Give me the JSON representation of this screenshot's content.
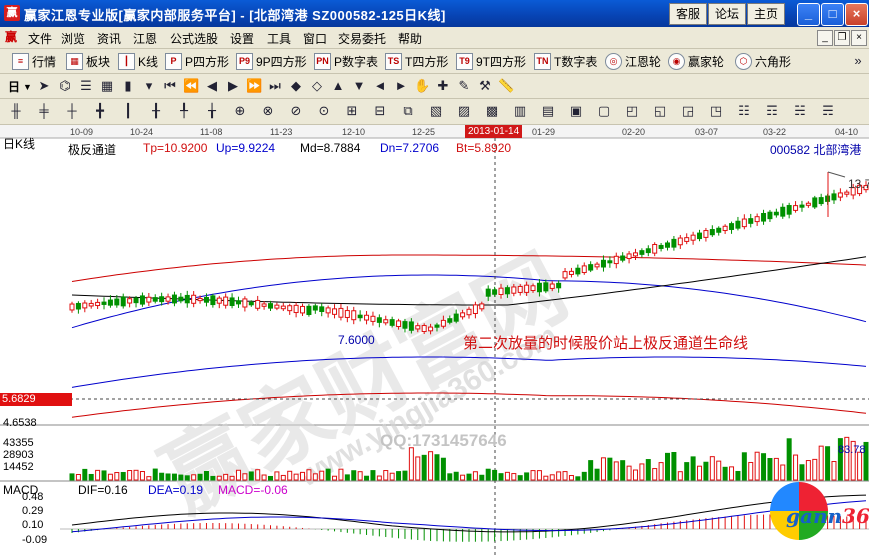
{
  "window": {
    "title": "赢家江恩专业版[赢家内部服务平台] - [北部湾港   SZ000582-125日K线]",
    "top_buttons": [
      "客服",
      "论坛",
      "主页"
    ],
    "controls": [
      "_",
      "□",
      "×"
    ]
  },
  "menu": {
    "items": [
      "文件",
      "浏览",
      "资讯",
      "江恩",
      "公式选股",
      "设置",
      "工具",
      "窗口",
      "交易委托",
      "帮助"
    ],
    "mdi_controls": [
      "_",
      "❐",
      "×"
    ]
  },
  "toolbar1": {
    "items": [
      {
        "icon": "list-icon",
        "label": "行情"
      },
      {
        "icon": "blocks-icon",
        "label": "板块"
      },
      {
        "icon": "candle-icon",
        "label": "K线"
      },
      {
        "icon": "P",
        "label": "P四方形"
      },
      {
        "icon": "P9",
        "label": "9P四方形"
      },
      {
        "icon": "PN",
        "label": "P数字表"
      },
      {
        "icon": "TS",
        "label": "T四方形"
      },
      {
        "icon": "T9",
        "label": "9T四方形"
      },
      {
        "icon": "TN",
        "label": "T数字表"
      },
      {
        "icon": "gann-wheel-icon",
        "label": "江恩轮"
      },
      {
        "icon": "winner-wheel-icon",
        "label": "赢家轮"
      },
      {
        "icon": "hexagon-icon",
        "label": "六角形"
      }
    ]
  },
  "toolbar2": {
    "period": "日",
    "icons": [
      "cursor-icon",
      "tree-icon",
      "stack-icon",
      "chart-icon",
      "bar-icon",
      "dropdown-icon",
      "first-icon",
      "prev-page-icon",
      "left-icon",
      "right-icon",
      "next-page-icon",
      "last-icon",
      "zoom-in-icon",
      "zoom-out-icon",
      "move-up-icon",
      "move-down-icon",
      "move-left-icon",
      "move-right-icon",
      "hand-icon",
      "crosshair-icon",
      "pen-icon",
      "tools-icon",
      "ruler-icon"
    ]
  },
  "toolbar3": {
    "icons": [
      "draw1-icon",
      "draw2-icon",
      "draw3-icon",
      "draw4-icon",
      "draw5-icon",
      "draw6-icon",
      "draw7-icon",
      "draw8-icon",
      "draw9-icon",
      "draw10-icon",
      "draw11-icon",
      "draw12-icon",
      "draw13-icon",
      "draw14-icon",
      "draw15-icon",
      "draw16-icon",
      "draw17-icon",
      "draw18-icon",
      "draw19-icon",
      "draw20-icon",
      "draw21-icon",
      "draw22-icon",
      "draw23-icon",
      "draw24-icon",
      "draw25-icon",
      "draw26-icon",
      "draw27-icon",
      "draw28-icon",
      "draw29-icon",
      "draw30-icon"
    ]
  },
  "chart": {
    "tab": "日K线",
    "indicator": {
      "name": "极反通道",
      "tp": "Tp=10.9200",
      "up": "Up=9.9224",
      "md": "Md=8.7884",
      "dn": "Dn=7.2706",
      "bt": "Bt=5.8920"
    },
    "stock": "000582  北部湾港",
    "dates": [
      "10-09",
      "10-24",
      "11-08",
      "11-23",
      "12-10",
      "12-25",
      "2013-01-14",
      "01-29",
      "02-20",
      "03-07",
      "03-22",
      "04-10"
    ],
    "high_label": "13.7",
    "low_label": "7.6000",
    "annotation": "第二次放量的时候股价站上极反通道生命线",
    "price_tag": "5.6829",
    "price_lower": "4.6538",
    "qq": "QQ:1731457646",
    "watermark": "赢家财富网",
    "watermark_url": "www.yingjia360.com",
    "volume_ticks": [
      "43355",
      "28903",
      "14452"
    ],
    "volume_right": "83.78",
    "macd": {
      "label": "MACD",
      "dif": "DIF=0.16",
      "dea": "DEA=0.19",
      "macd": "MACD=-0.06",
      "ticks": [
        "0.48",
        "0.29",
        "0.10",
        "-0.09"
      ]
    },
    "logo": {
      "text": "gann",
      "num": "360"
    },
    "colors": {
      "up": "#e01010",
      "down": "#009000",
      "mid_band": "#000000",
      "inner_band": "#0000cc",
      "outer_band": "#cc0000"
    }
  }
}
